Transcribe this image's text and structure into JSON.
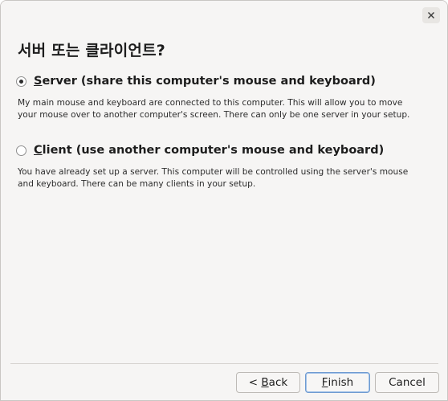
{
  "dialog": {
    "title": "서버 또는 클라이언트?"
  },
  "options": {
    "server": {
      "selected": true,
      "mnemonic": "S",
      "label_rest": "erver (share this computer's mouse and keyboard)",
      "description": "My main mouse and keyboard are connected to this computer. This will allow you to move your mouse over to another computer's screen. There can only be one server in your setup."
    },
    "client": {
      "selected": false,
      "mnemonic": "C",
      "label_rest": "lient (use another computer's mouse and keyboard)",
      "description": "You have already set up a server. This computer will be controlled using the server's mouse and keyboard. There can be many clients in your setup."
    }
  },
  "buttons": {
    "back_prefix": "< ",
    "back_mnemonic": "B",
    "back_rest": "ack",
    "finish_mnemonic": "F",
    "finish_rest": "inish",
    "cancel": "Cancel"
  },
  "icons": {
    "close": "close-icon"
  },
  "colors": {
    "window_bg": "#f6f5f4",
    "default_button_border": "#6f9bd1"
  }
}
